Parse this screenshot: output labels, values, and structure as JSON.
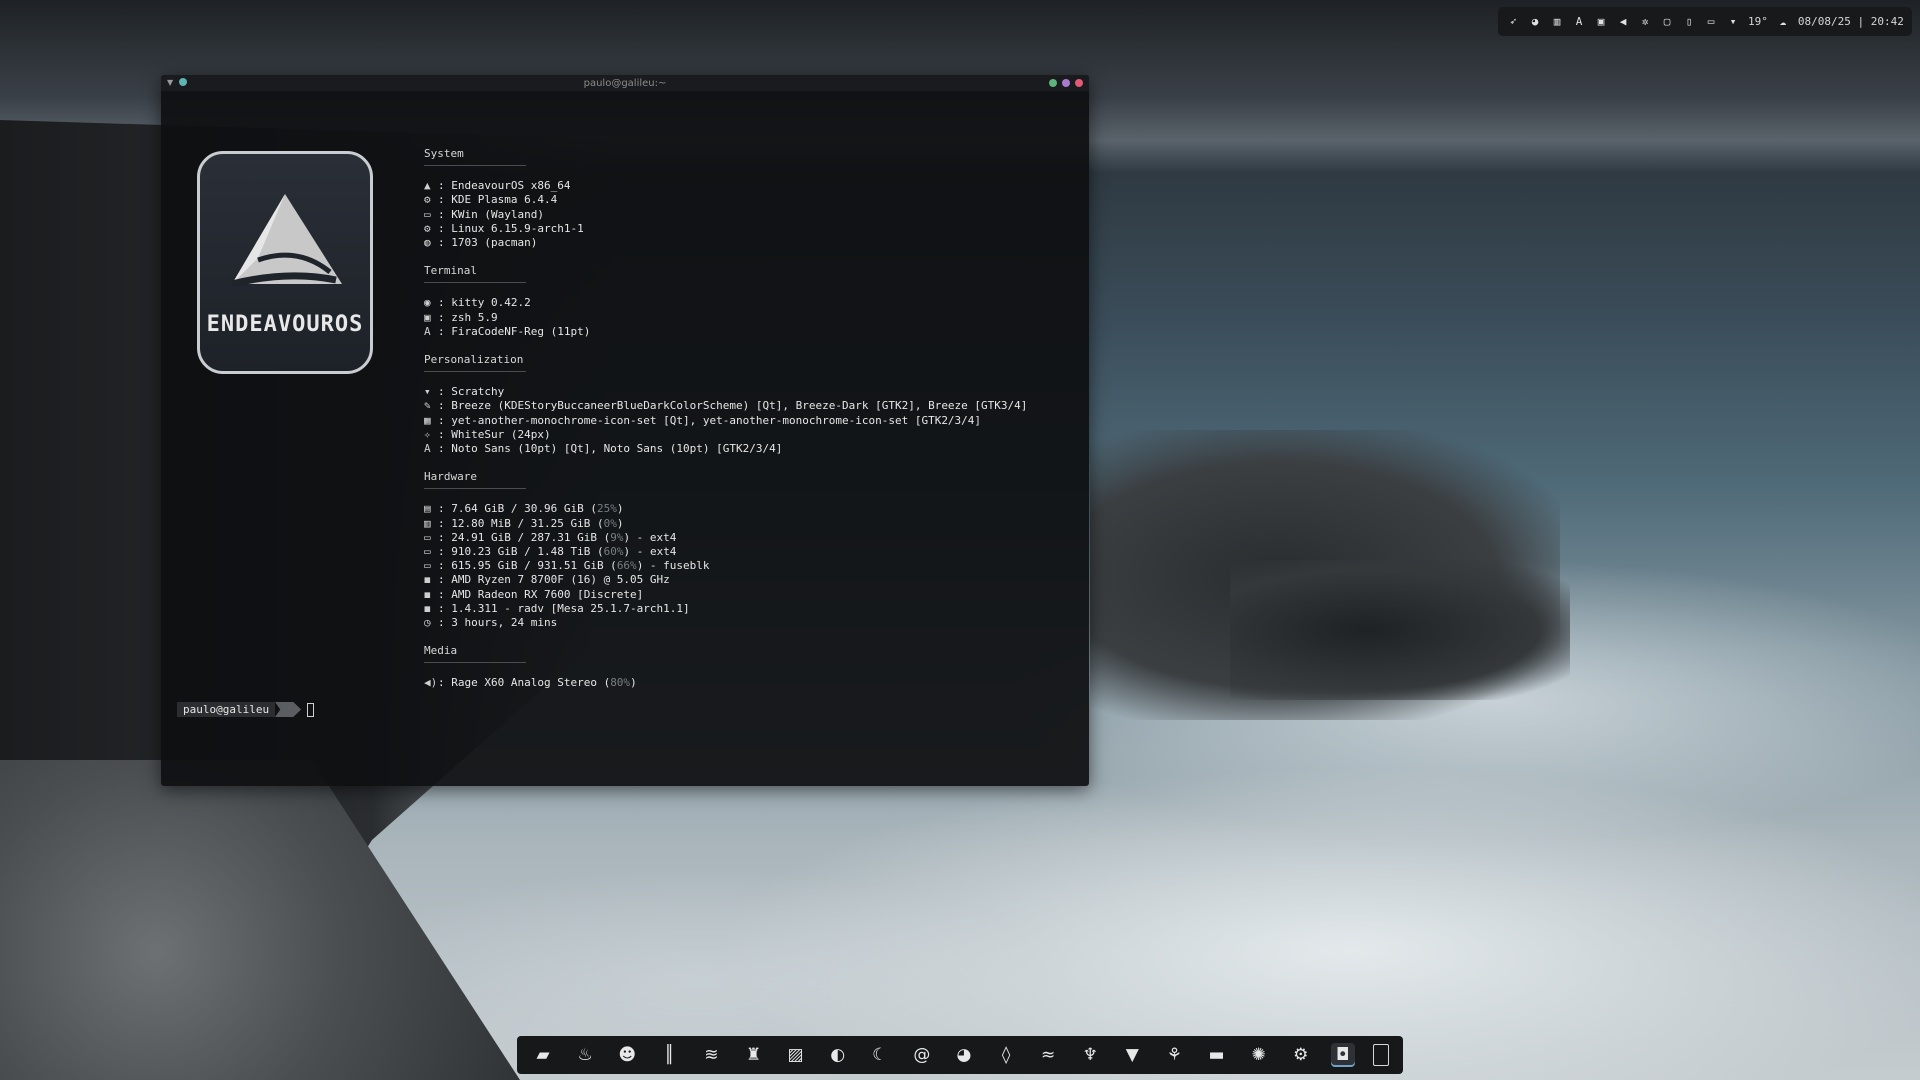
{
  "tray": {
    "icons": [
      "rocket-icon",
      "discord-icon",
      "chart-icon",
      "font-icon",
      "clipboard-icon",
      "volume-icon",
      "settings-icon",
      "lock-icon",
      "battery-icon",
      "display-icon",
      "chevron-down-icon"
    ],
    "temperature": "19°",
    "weather_icon": "cloud-icon",
    "datetime": "08/08/25 | 20:42"
  },
  "terminal": {
    "title": "paulo@galileu:~",
    "logo_text": "ENDEAVOUROS",
    "sections": {
      "system": {
        "title": "System",
        "rows": [
          {
            "icon": "▲",
            "text": ": EndeavourOS x86_64"
          },
          {
            "icon": "⚙",
            "text": ": KDE Plasma 6.4.4"
          },
          {
            "icon": "▭",
            "text": ": KWin (Wayland)"
          },
          {
            "icon": "⚙",
            "text": ": Linux 6.15.9-arch1-1"
          },
          {
            "icon": "◍",
            "text": ": 1703 (pacman)"
          }
        ]
      },
      "terminal": {
        "title": "Terminal",
        "rows": [
          {
            "icon": "◉",
            "text": ": kitty 0.42.2"
          },
          {
            "icon": "▣",
            "text": ": zsh 5.9"
          },
          {
            "icon": "A",
            "text": ": FiraCodeNF-Reg (11pt)"
          }
        ]
      },
      "personalization": {
        "title": "Personalization",
        "rows": [
          {
            "icon": "▾",
            "text": ": Scratchy"
          },
          {
            "icon": "✎",
            "text": ": Breeze (KDEStoryBuccaneerBlueDarkColorScheme) [Qt], Breeze-Dark [GTK2], Breeze [GTK3/4]"
          },
          {
            "icon": "▦",
            "text": ": yet-another-monochrome-icon-set [Qt], yet-another-monochrome-icon-set [GTK2/3/4]"
          },
          {
            "icon": "✧",
            "text": ": WhiteSur (24px)"
          },
          {
            "icon": "A",
            "text": ": Noto Sans (10pt) [Qt], Noto Sans (10pt) [GTK2/3/4]"
          }
        ]
      },
      "hardware": {
        "title": "Hardware",
        "rows": [
          {
            "icon": "▤",
            "pre": ": 7.64 GiB / 30.96 GiB (",
            "pct": "25%",
            "post": ")"
          },
          {
            "icon": "▥",
            "pre": ": 12.80 MiB / 31.25 GiB (",
            "pct": "0%",
            "post": ")"
          },
          {
            "icon": "▭",
            "pre": ": 24.91 GiB / 287.31 GiB (",
            "pct": "9%",
            "post": ") - ext4"
          },
          {
            "icon": "▭",
            "pre": ": 910.23 GiB / 1.48 TiB (",
            "pct": "60%",
            "post": ") - ext4"
          },
          {
            "icon": "▭",
            "pre": ": 615.95 GiB / 931.51 GiB (",
            "pct": "66%",
            "post": ") - fuseblk"
          },
          {
            "icon": "◼",
            "pre": ": AMD Ryzen 7 8700F (16) @ 5.05 GHz",
            "pct": "",
            "post": ""
          },
          {
            "icon": "◼",
            "pre": ": AMD Radeon RX 7600 [Discrete]",
            "pct": "",
            "post": ""
          },
          {
            "icon": "◼",
            "pre": ": 1.4.311 - radv [Mesa 25.1.7-arch1.1]",
            "pct": "",
            "post": ""
          },
          {
            "icon": "◷",
            "pre": ": 3 hours, 24 mins",
            "pct": "",
            "post": ""
          }
        ]
      },
      "media": {
        "title": "Media",
        "rows": [
          {
            "icon": "◀)",
            "pre": ": Rage X60 Analog Stereo (",
            "pct": "80%",
            "post": ")"
          }
        ]
      }
    },
    "prompt_user": "paulo@galileu",
    "prompt_arrow": "~"
  },
  "dock": {
    "items": [
      {
        "name": "files-icon",
        "glyph": "▰"
      },
      {
        "name": "flame-icon",
        "glyph": "♨"
      },
      {
        "name": "ghost-icon",
        "glyph": "☻"
      },
      {
        "name": "library-icon",
        "glyph": "║"
      },
      {
        "name": "layers-icon",
        "glyph": "≋"
      },
      {
        "name": "castle-icon",
        "glyph": "♜"
      },
      {
        "name": "image-editor-icon",
        "glyph": "▨"
      },
      {
        "name": "yuzu-icon",
        "glyph": "◐"
      },
      {
        "name": "moon-icon",
        "glyph": "☾"
      },
      {
        "name": "mail-icon",
        "glyph": "@"
      },
      {
        "name": "discord-icon",
        "glyph": "◕"
      },
      {
        "name": "drop-icon",
        "glyph": "◊"
      },
      {
        "name": "spotify-icon",
        "glyph": "≈"
      },
      {
        "name": "joystick-icon",
        "glyph": "♆"
      },
      {
        "name": "shield-icon",
        "glyph": "▼"
      },
      {
        "name": "steam-icon",
        "glyph": "⚘"
      },
      {
        "name": "terminal-icon",
        "glyph": "▬"
      },
      {
        "name": "aperture-icon",
        "glyph": "✺"
      },
      {
        "name": "settings-icon",
        "glyph": "⚙"
      },
      {
        "name": "screenshot-icon",
        "glyph": "◘"
      },
      {
        "name": "desktop-icon",
        "glyph": ""
      }
    ]
  }
}
